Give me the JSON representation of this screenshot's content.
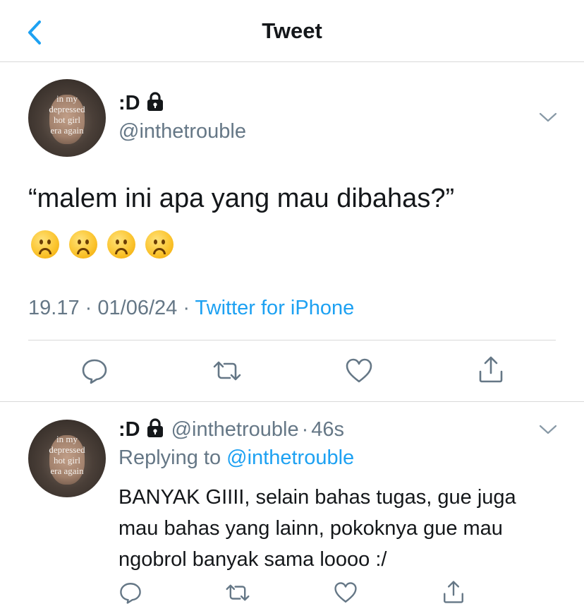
{
  "header": {
    "title": "Tweet"
  },
  "tweet": {
    "display_name": ":D",
    "handle": "@inthetrouble",
    "avatar_text": [
      "in my",
      "depressed",
      "hot girl",
      "era again"
    ],
    "text": "“malem ini apa yang mau dibahas?”",
    "emojis": [
      "frowning-face",
      "frowning-face",
      "frowning-face",
      "frowning-face"
    ],
    "time": "19.17",
    "date": "01/06/24",
    "separator": "·",
    "source": "Twitter for iPhone"
  },
  "reply": {
    "display_name": ":D",
    "handle": "@inthetrouble",
    "separator": "·",
    "age": "46s",
    "replying_label": "Replying to",
    "replying_to": "@inthetrouble",
    "avatar_text": [
      "in my",
      "depressed",
      "hot girl",
      "era again"
    ],
    "text_lines": [
      "BANYAK GIIII, selain bahas tugas, gue juga",
      "mau bahas yang lainn, pokoknya gue mau",
      "ngobrol banyak sama loooo :/"
    ]
  },
  "colors": {
    "accent": "#1da1f2",
    "secondary_text": "#657786",
    "icon_gray": "#657786"
  }
}
